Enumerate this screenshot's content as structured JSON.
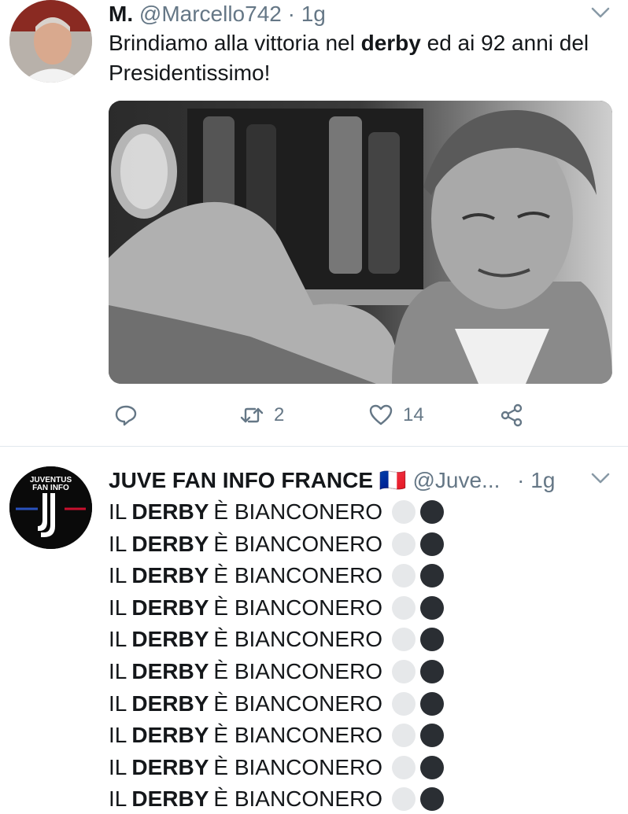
{
  "tweet1": {
    "display_name": "M.",
    "handle": "@Marcello742",
    "separator": "·",
    "time": "1g",
    "text_before": "Brindiamo alla vittoria nel ",
    "text_bold": "derby",
    "text_after": " ed ai 92 anni del Presidentissimo!",
    "retweet_count": "2",
    "like_count": "14",
    "avatar_icon": "person-photo",
    "media_icon": "black-and-white-photo"
  },
  "tweet2": {
    "display_name": "JUVE FAN INFO FRANCE",
    "flag": "🇫🇷",
    "handle": "@Juve...",
    "separator": "·",
    "time": "1g",
    "avatar_logo_line1": "JUVENTUS",
    "avatar_logo_line2": "FAN INFO",
    "line_prefix": "IL",
    "line_bold": "DERBY",
    "line_suffix": "È BIANCONERO",
    "lines": [
      1,
      2,
      3,
      4,
      5,
      6,
      7,
      8,
      9,
      10
    ]
  },
  "colors": {
    "text": "#14171a",
    "secondary": "#657786",
    "divider": "#e1e8ed",
    "white_circle": "#e6e8ea",
    "black_circle": "#2a2e33"
  }
}
